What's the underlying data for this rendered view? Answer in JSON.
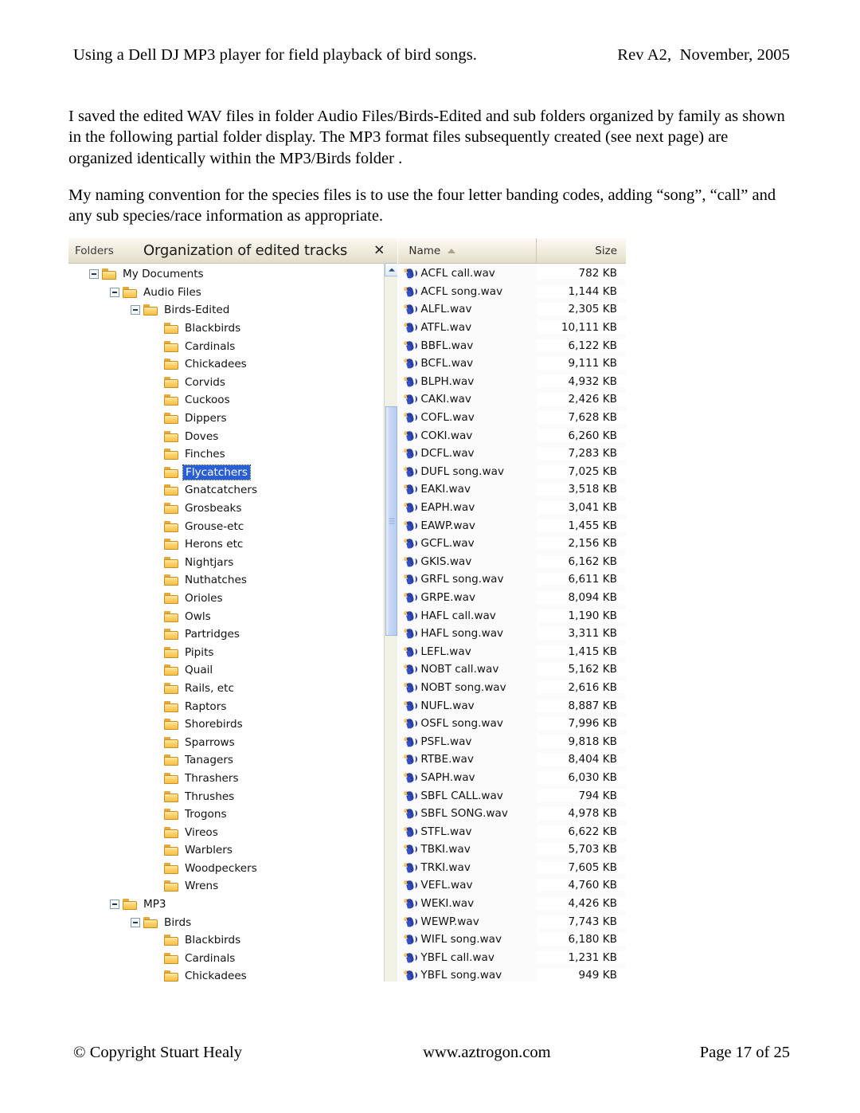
{
  "document": {
    "header_left": "Using a Dell DJ MP3 player for field playback of bird songs.",
    "header_right": "Rev A2,  November, 2005",
    "paragraph1": "I saved the edited WAV files in folder Audio Files/Birds-Edited and sub folders organized by family as shown in the following partial folder display. The MP3 format files subsequently created (see next page) are organized identically within the MP3/Birds folder .",
    "paragraph2": "My naming convention for the species files is to use the four letter banding codes, adding “song”, “call” and any sub species/race information as appropriate.",
    "footer_left": "© Copyright Stuart Healy",
    "footer_center": "www.aztrogon.com",
    "footer_right": "Page 17 of 25"
  },
  "explorer": {
    "folders_label": "Folders",
    "window_title": "Organization of edited tracks",
    "close_label": "✕",
    "columns": {
      "name": "Name",
      "size": "Size",
      "sort": "ascending"
    },
    "colors": {
      "selection": "#2a5fd4",
      "titlebar": "#e6e1cd",
      "folder_icon": "#f6bf47",
      "wav_icon": "#2b3f9e"
    },
    "tree": [
      {
        "label": "My Documents",
        "indent": 1,
        "expander": "minus"
      },
      {
        "label": "Audio Files",
        "indent": 2,
        "expander": "minus"
      },
      {
        "label": "Birds-Edited",
        "indent": 3,
        "expander": "minus"
      },
      {
        "label": "Blackbirds",
        "indent": 4,
        "expander": "none"
      },
      {
        "label": "Cardinals",
        "indent": 4,
        "expander": "none"
      },
      {
        "label": "Chickadees",
        "indent": 4,
        "expander": "none"
      },
      {
        "label": "Corvids",
        "indent": 4,
        "expander": "none"
      },
      {
        "label": "Cuckoos",
        "indent": 4,
        "expander": "none"
      },
      {
        "label": "Dippers",
        "indent": 4,
        "expander": "none"
      },
      {
        "label": "Doves",
        "indent": 4,
        "expander": "none"
      },
      {
        "label": "Finches",
        "indent": 4,
        "expander": "none"
      },
      {
        "label": "Flycatchers",
        "indent": 4,
        "expander": "none",
        "selected": true
      },
      {
        "label": "Gnatcatchers",
        "indent": 4,
        "expander": "none"
      },
      {
        "label": "Grosbeaks",
        "indent": 4,
        "expander": "none"
      },
      {
        "label": "Grouse-etc",
        "indent": 4,
        "expander": "none"
      },
      {
        "label": "Herons etc",
        "indent": 4,
        "expander": "none"
      },
      {
        "label": "Nightjars",
        "indent": 4,
        "expander": "none"
      },
      {
        "label": "Nuthatches",
        "indent": 4,
        "expander": "none"
      },
      {
        "label": "Orioles",
        "indent": 4,
        "expander": "none"
      },
      {
        "label": "Owls",
        "indent": 4,
        "expander": "none"
      },
      {
        "label": "Partridges",
        "indent": 4,
        "expander": "none"
      },
      {
        "label": "Pipits",
        "indent": 4,
        "expander": "none"
      },
      {
        "label": "Quail",
        "indent": 4,
        "expander": "none"
      },
      {
        "label": "Rails, etc",
        "indent": 4,
        "expander": "none"
      },
      {
        "label": "Raptors",
        "indent": 4,
        "expander": "none"
      },
      {
        "label": "Shorebirds",
        "indent": 4,
        "expander": "none"
      },
      {
        "label": "Sparrows",
        "indent": 4,
        "expander": "none"
      },
      {
        "label": "Tanagers",
        "indent": 4,
        "expander": "none"
      },
      {
        "label": "Thrashers",
        "indent": 4,
        "expander": "none"
      },
      {
        "label": "Thrushes",
        "indent": 4,
        "expander": "none"
      },
      {
        "label": "Trogons",
        "indent": 4,
        "expander": "none"
      },
      {
        "label": "Vireos",
        "indent": 4,
        "expander": "none"
      },
      {
        "label": "Warblers",
        "indent": 4,
        "expander": "none"
      },
      {
        "label": "Woodpeckers",
        "indent": 4,
        "expander": "none"
      },
      {
        "label": "Wrens",
        "indent": 4,
        "expander": "none"
      },
      {
        "label": "MP3",
        "indent": 2,
        "expander": "minus"
      },
      {
        "label": "Birds",
        "indent": 3,
        "expander": "minus"
      },
      {
        "label": "Blackbirds",
        "indent": 4,
        "expander": "none"
      },
      {
        "label": "Cardinals",
        "indent": 4,
        "expander": "none"
      },
      {
        "label": "Chickadees",
        "indent": 4,
        "expander": "none"
      }
    ],
    "files": [
      {
        "name": "ACFL call.wav",
        "size": "782 KB"
      },
      {
        "name": "ACFL song.wav",
        "size": "1,144 KB"
      },
      {
        "name": "ALFL.wav",
        "size": "2,305 KB"
      },
      {
        "name": "ATFL.wav",
        "size": "10,111 KB"
      },
      {
        "name": "BBFL.wav",
        "size": "6,122 KB"
      },
      {
        "name": "BCFL.wav",
        "size": "9,111 KB"
      },
      {
        "name": "BLPH.wav",
        "size": "4,932 KB"
      },
      {
        "name": "CAKI.wav",
        "size": "2,426 KB"
      },
      {
        "name": "COFL.wav",
        "size": "7,628 KB"
      },
      {
        "name": "COKI.wav",
        "size": "6,260 KB"
      },
      {
        "name": "DCFL.wav",
        "size": "7,283 KB"
      },
      {
        "name": "DUFL song.wav",
        "size": "7,025 KB"
      },
      {
        "name": "EAKI.wav",
        "size": "3,518 KB"
      },
      {
        "name": "EAPH.wav",
        "size": "3,041 KB"
      },
      {
        "name": "EAWP.wav",
        "size": "1,455 KB"
      },
      {
        "name": "GCFL.wav",
        "size": "2,156 KB"
      },
      {
        "name": "GKIS.wav",
        "size": "6,162 KB"
      },
      {
        "name": "GRFL song.wav",
        "size": "6,611 KB"
      },
      {
        "name": "GRPE.wav",
        "size": "8,094 KB"
      },
      {
        "name": "HAFL call.wav",
        "size": "1,190 KB"
      },
      {
        "name": "HAFL song.wav",
        "size": "3,311 KB"
      },
      {
        "name": "LEFL.wav",
        "size": "1,415 KB"
      },
      {
        "name": "NOBT call.wav",
        "size": "5,162 KB"
      },
      {
        "name": "NOBT song.wav",
        "size": "2,616 KB"
      },
      {
        "name": "NUFL.wav",
        "size": "8,887 KB"
      },
      {
        "name": "OSFL song.wav",
        "size": "7,996 KB"
      },
      {
        "name": "PSFL.wav",
        "size": "9,818 KB"
      },
      {
        "name": "RTBE.wav",
        "size": "8,404 KB"
      },
      {
        "name": "SAPH.wav",
        "size": "6,030 KB"
      },
      {
        "name": "SBFL CALL.wav",
        "size": "794 KB"
      },
      {
        "name": "SBFL SONG.wav",
        "size": "4,978 KB"
      },
      {
        "name": "STFL.wav",
        "size": "6,622 KB"
      },
      {
        "name": "TBKI.wav",
        "size": "5,703 KB"
      },
      {
        "name": "TRKI.wav",
        "size": "7,605 KB"
      },
      {
        "name": "VEFL.wav",
        "size": "4,760 KB"
      },
      {
        "name": "WEKI.wav",
        "size": "4,426 KB"
      },
      {
        "name": "WEWP.wav",
        "size": "7,743 KB"
      },
      {
        "name": "WIFL song.wav",
        "size": "6,180 KB"
      },
      {
        "name": "YBFL call.wav",
        "size": "1,231 KB"
      },
      {
        "name": "YBFL song.wav",
        "size": "949 KB"
      }
    ]
  }
}
